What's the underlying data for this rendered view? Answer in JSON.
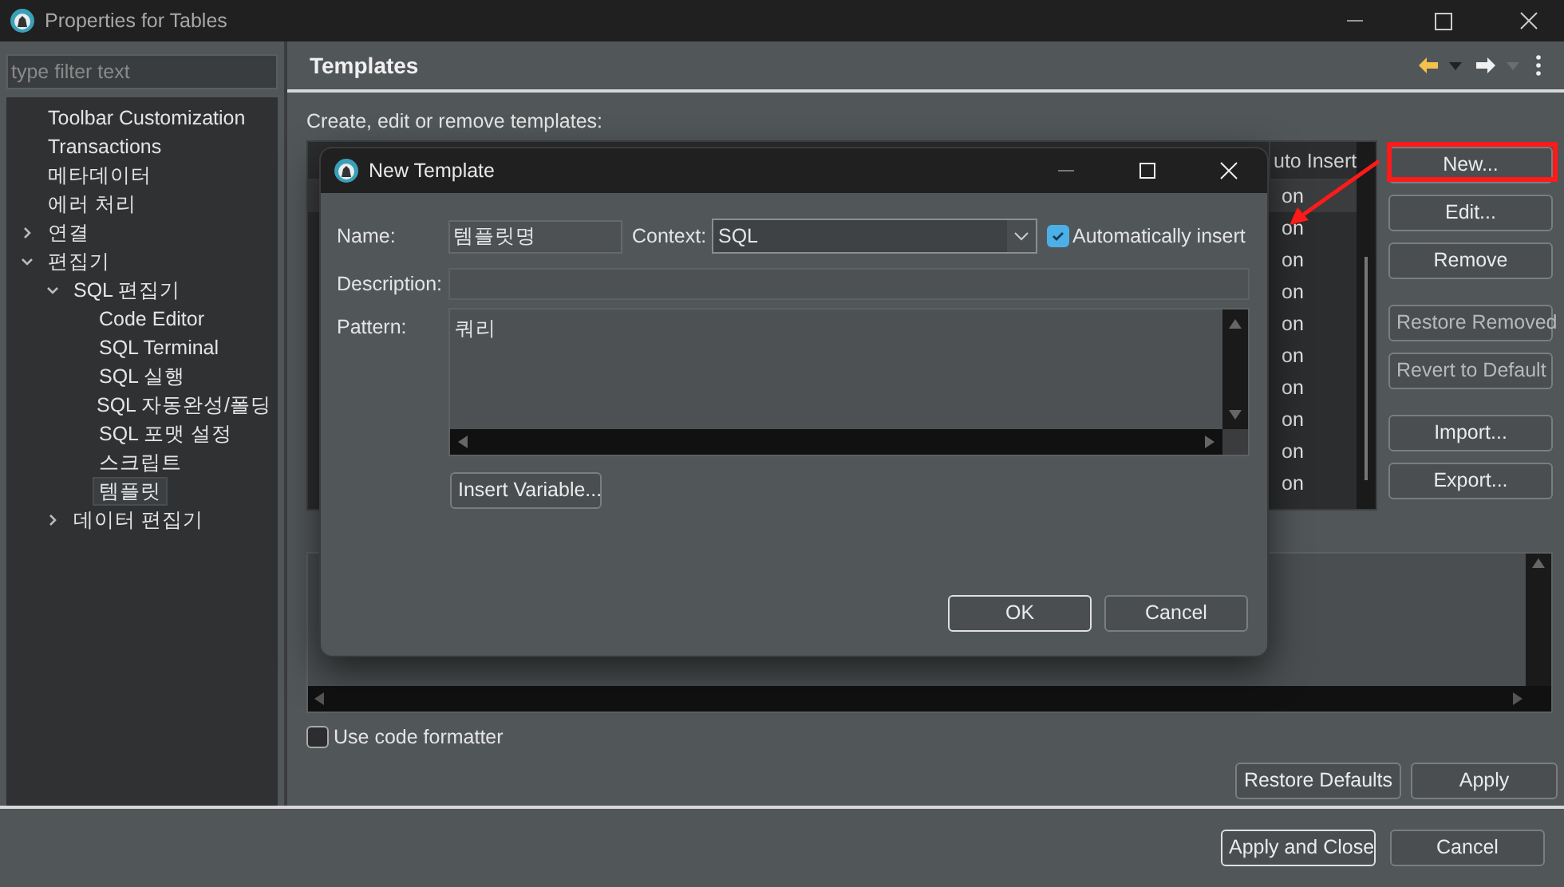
{
  "window": {
    "title": "Properties for Tables"
  },
  "filter": {
    "placeholder": "type filter text"
  },
  "tree": [
    {
      "label": "Toolbar Customization",
      "selected": false
    },
    {
      "label": "Transactions",
      "selected": false
    },
    {
      "label": "메타데이터",
      "selected": false
    },
    {
      "label": "에러 처리",
      "selected": false
    },
    {
      "label": "연결",
      "selected": false,
      "expanded": false
    },
    {
      "label": "편집기",
      "selected": false,
      "expanded": true,
      "children": [
        {
          "label": "SQL 편집기",
          "selected": false,
          "expanded": true,
          "children": [
            {
              "label": "Code Editor",
              "selected": false
            },
            {
              "label": "SQL Terminal",
              "selected": false
            },
            {
              "label": "SQL 실행",
              "selected": false
            },
            {
              "label": "SQL 자동완성/폴딩",
              "selected": false
            },
            {
              "label": "SQL 포맷 설정",
              "selected": false
            },
            {
              "label": "스크립트",
              "selected": false
            },
            {
              "label": "템플릿",
              "selected": true
            }
          ]
        },
        {
          "label": "데이터 편집기",
          "selected": false,
          "expanded": false
        }
      ]
    }
  ],
  "page": {
    "title": "Templates",
    "description": "Create, edit or remove templates:",
    "table": {
      "columns": [
        "uto Insert"
      ],
      "rows": [
        {
          "column_1": "on",
          "selected": true
        },
        {
          "column_1": "on",
          "selected": false
        },
        {
          "column_1": "on",
          "selected": false
        },
        {
          "column_1": "on",
          "selected": false
        },
        {
          "column_1": "on",
          "selected": false
        },
        {
          "column_1": "on",
          "selected": false
        },
        {
          "column_1": "on",
          "selected": false
        },
        {
          "column_1": "on",
          "selected": false
        },
        {
          "column_1": "on",
          "selected": false
        },
        {
          "column_1": "on",
          "selected": false
        }
      ]
    },
    "side_buttons": [
      [
        {
          "label": "New...",
          "disabled": false
        },
        {
          "label": "Edit...",
          "disabled": false
        },
        {
          "label": "Remove",
          "disabled": false
        }
      ],
      [
        {
          "label": "Restore Removed",
          "disabled": true
        },
        {
          "label": "Revert to Default",
          "disabled": true
        }
      ],
      [
        {
          "label": "Import...",
          "disabled": false
        },
        {
          "label": "Export...",
          "disabled": false
        }
      ]
    ],
    "use_code_formatter": {
      "label": "Use code formatter",
      "checked": false
    },
    "buttons": [
      "Restore Defaults",
      "Apply"
    ]
  },
  "dialog": {
    "title": "New Template",
    "name_label": "Name:",
    "name": "템플릿명",
    "context_label": "Context:",
    "context": "SQL",
    "auto_insert": {
      "label": "Automatically insert",
      "checked": true
    },
    "description_label": "Description:",
    "pattern_label": "Pattern:",
    "pattern": "쿼리",
    "insert_variable": "Insert Variable...",
    "buttons": [
      {
        "label": "OK",
        "default": true
      },
      {
        "label": "Cancel",
        "default": false
      }
    ]
  },
  "footer": {
    "buttons": [
      {
        "label": "Apply and Close",
        "default": true
      },
      {
        "label": "Cancel",
        "default": false
      }
    ]
  }
}
